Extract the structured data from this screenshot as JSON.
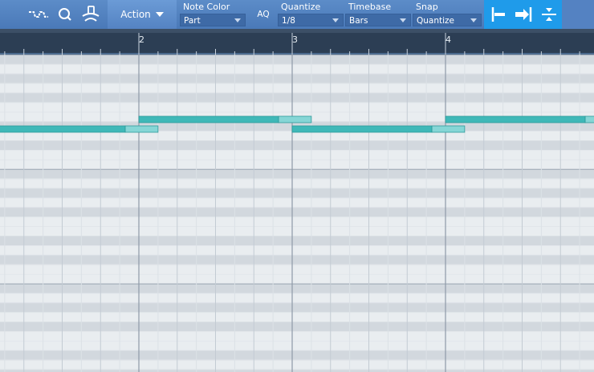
{
  "toolbar": {
    "action_label": "Action",
    "aq_label": "AQ",
    "note_color": {
      "label": "Note Color",
      "value": "Part"
    },
    "quantize": {
      "label": "Quantize",
      "value": "1/8"
    },
    "timebase": {
      "label": "Timebase",
      "value": "Bars"
    },
    "snap": {
      "label": "Snap",
      "value": "Quantize"
    },
    "icons": [
      "line-draw-tool-icon",
      "zoom-tool-icon",
      "listen-tool-icon",
      "snap-to-start-icon",
      "snap-arrow-icon",
      "snap-split-icon"
    ],
    "accent_color": "#1f9bea"
  },
  "ruler": {
    "bars": [
      "2",
      "3",
      "4"
    ]
  },
  "notes": [
    {
      "start_beat": 0.0,
      "length_beats": 4.5,
      "pitch_row": 7
    },
    {
      "start_beat": 4.0,
      "length_beats": 4.5,
      "pitch_row": 6
    },
    {
      "start_beat": 8.0,
      "length_beats": 4.5,
      "pitch_row": 7
    },
    {
      "start_beat": 12.0,
      "length_beats": 4.5,
      "pitch_row": 6
    }
  ],
  "colors": {
    "note": "#3fb8b8",
    "note_tail": "#86d6d6"
  }
}
